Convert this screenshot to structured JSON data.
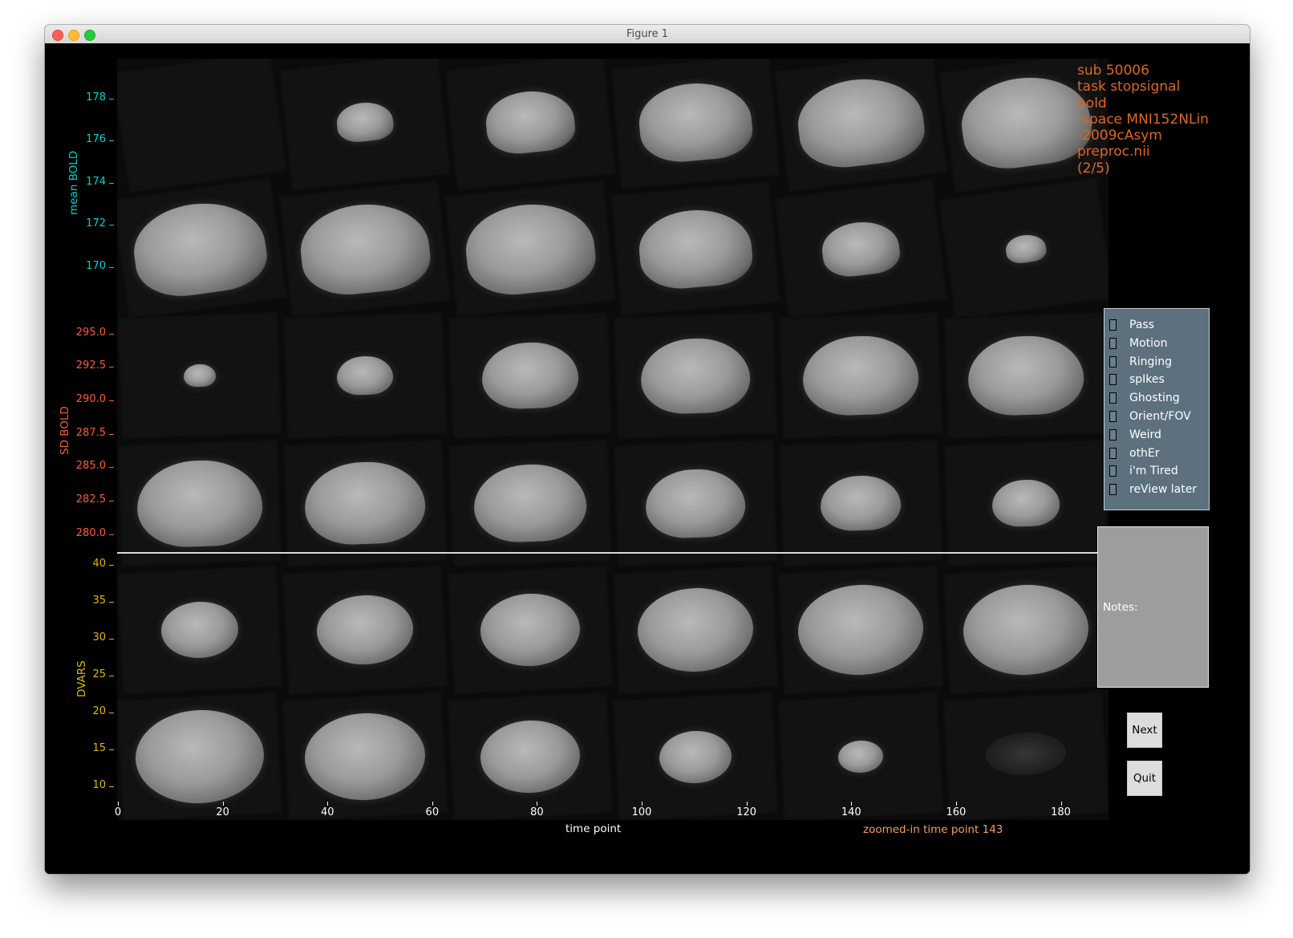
{
  "window": {
    "title": "Figure 1"
  },
  "info_text": [
    "sub 50006",
    "task stopsignal",
    "bold",
    "-space MNI152NLin",
    "-2009cAsym",
    "preproc.nii",
    "(2/5)"
  ],
  "axes": {
    "mean_bold": {
      "label": "mean BOLD",
      "color": "#00d4d4",
      "ticks": [
        "178",
        "176",
        "174",
        "172",
        "170"
      ]
    },
    "sd_bold": {
      "label": "SD BOLD",
      "color": "#ff5a36",
      "ticks": [
        "295.0",
        "292.5",
        "290.0",
        "287.5",
        "285.0",
        "282.5",
        "280.0"
      ]
    },
    "dvars": {
      "label": "DVARS",
      "color": "#e0b800",
      "ticks": [
        "40",
        "35",
        "30",
        "25",
        "20",
        "15",
        "10"
      ]
    },
    "x": {
      "label": "time point",
      "ticks": [
        "0",
        "20",
        "40",
        "60",
        "80",
        "100",
        "120",
        "140",
        "160",
        "180"
      ]
    }
  },
  "zoom_label": "zoomed-in time point 143",
  "checkboxes": [
    "Pass",
    "Motion",
    "Ringing",
    "spIkes",
    "Ghosting",
    "Orient/FOV",
    "Weird",
    "othEr",
    "i'm Tired",
    "reView later"
  ],
  "notes_label": "Notes:",
  "buttons": {
    "next": "Next",
    "quit": "Quit"
  },
  "colors": {
    "panel": "#5c707e",
    "notes_bg": "#9d9e9c",
    "info_text": "#e0661f",
    "zoom_text": "#f0a15b"
  }
}
